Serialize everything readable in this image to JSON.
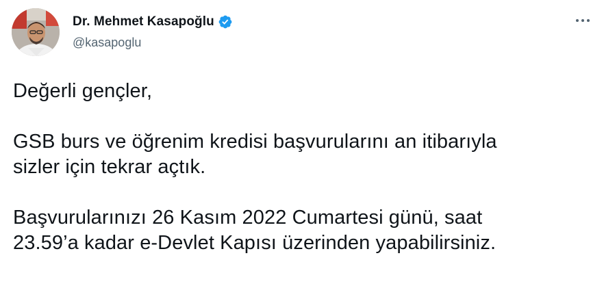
{
  "author": {
    "display_name": "Dr. Mehmet Kasapoğlu",
    "handle": "@kasapoglu",
    "verified": true
  },
  "icons": {
    "verified": "verified-badge-icon",
    "more": "more-options-icon",
    "avatar": "profile-photo"
  },
  "colors": {
    "verified_badge": "#1d9bf0",
    "text_primary": "#0f1419",
    "text_secondary": "#536471"
  },
  "tweet": {
    "paragraphs": [
      {
        "lines": [
          "Değerli gençler,"
        ]
      },
      {
        "lines": [
          "GSB burs ve öğrenim kredisi başvurularını an itibarıyla",
          "sizler için tekrar açtık."
        ]
      },
      {
        "lines": [
          "Başvurularınızı 26 Kasım 2022 Cumartesi günü, saat",
          "23.59’a kadar e-Devlet Kapısı üzerinden yapabilirsiniz."
        ]
      }
    ]
  }
}
